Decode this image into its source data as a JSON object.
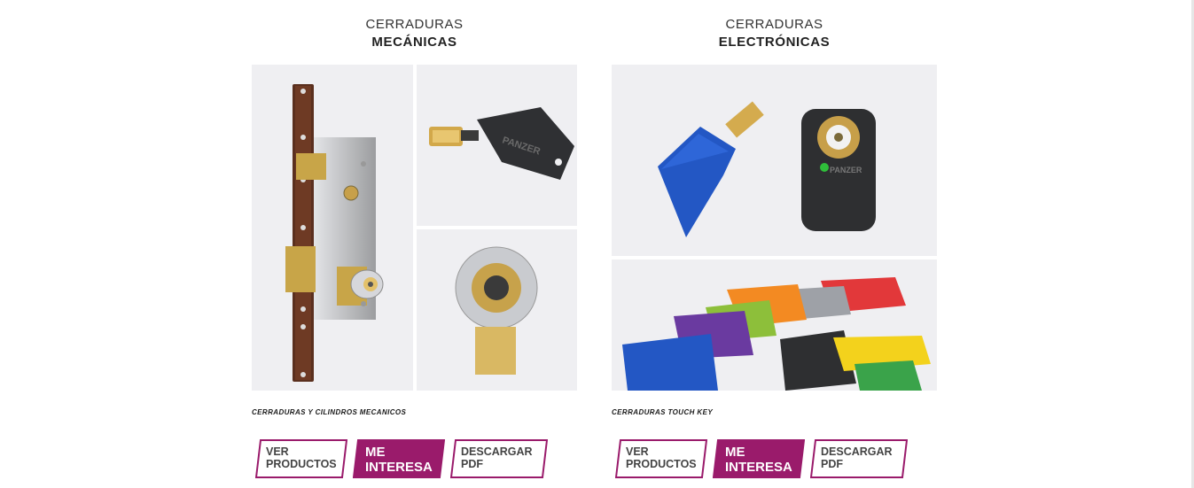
{
  "colors": {
    "accent": "#9a1b6b",
    "photo_bg": "#eeeef1"
  },
  "cards": [
    {
      "heading_light": "CERRADURAS",
      "heading_bold": "MECÁNICAS",
      "caption": "CERRADURAS Y CILINDROS MECANICOS",
      "buttons": {
        "ver": "VER\nPRODUCTOS",
        "interesa": "ME\nINTERESA",
        "pdf": "DESCARGAR\nPDF"
      }
    },
    {
      "heading_light": "CERRADURAS",
      "heading_bold": "ELECTRÓNICAS",
      "caption": "CERRADURAS TOUCH KEY",
      "buttons": {
        "ver": "VER\nPRODUCTOS",
        "interesa": "ME\nINTERESA",
        "pdf": "DESCARGAR\nPDF"
      }
    }
  ],
  "images": {
    "mortise_lock": "mortise-lock-photo",
    "black_key": "black-panzer-key-photo",
    "cylinder": "lock-cylinder-photo",
    "blue_key_reader": "blue-key-and-reader-photo",
    "colored_keys": "colored-keys-photo"
  },
  "logo_text": {
    "key_brand": "PANZER"
  }
}
